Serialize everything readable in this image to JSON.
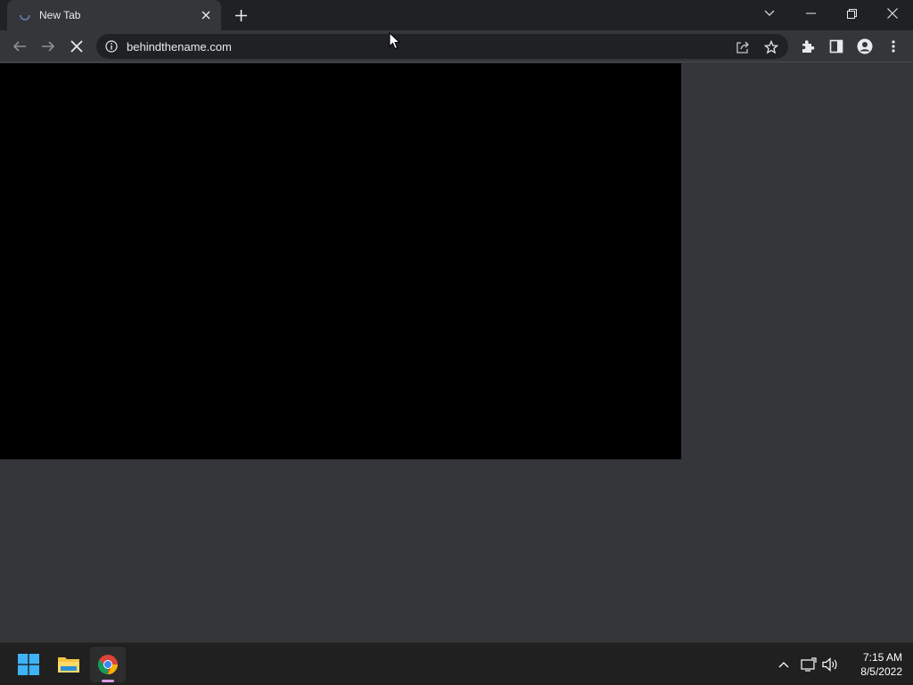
{
  "browser": {
    "tab": {
      "title": "New Tab",
      "close_icon": "close-icon",
      "loading_icon": "spinner-icon"
    },
    "new_tab_icon": "plus-icon",
    "window_controls": [
      "chevron-down-icon",
      "minimize-icon",
      "restore-icon",
      "close-icon"
    ],
    "toolbar": {
      "back_icon": "back-arrow-icon",
      "forward_icon": "forward-arrow-icon",
      "stop_icon": "stop-icon",
      "url": "behindthename.com",
      "site_info_icon": "info-icon",
      "share_icon": "share-icon",
      "bookmark_icon": "star-icon",
      "extensions_icon": "puzzle-icon",
      "side_panel_icon": "side-panel-icon",
      "profile_icon": "profile-icon",
      "menu_icon": "kebab-menu-icon"
    }
  },
  "taskbar": {
    "apps": [
      {
        "name": "Start",
        "icon": "windows-logo-icon"
      },
      {
        "name": "File Explorer",
        "icon": "folder-icon"
      },
      {
        "name": "Google Chrome",
        "icon": "chrome-icon",
        "active": true
      }
    ],
    "tray_icons": [
      "chevron-up-icon",
      "network-icon",
      "volume-icon"
    ],
    "clock": {
      "time": "7:15 AM",
      "date": "8/5/2022"
    }
  },
  "colors": {
    "tabstrip": "#202124",
    "toolbar": "#35363a",
    "omnibox": "#202124",
    "content_bg": "#35363a",
    "page_block": "#000000",
    "taskbar": "#202020",
    "active_indicator": "#d69fe0"
  }
}
